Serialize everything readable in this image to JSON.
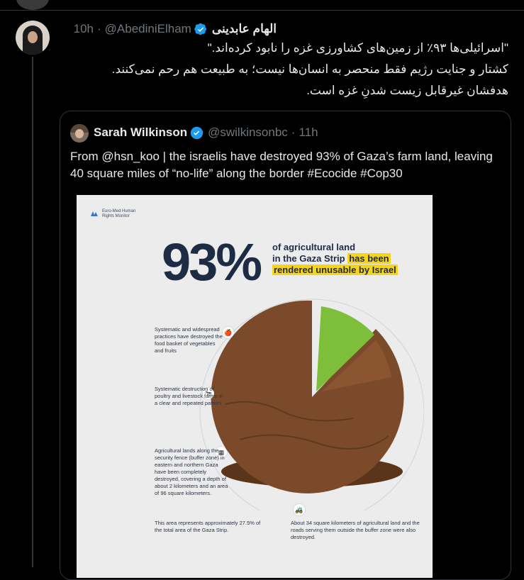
{
  "main_tweet": {
    "name": "الهام عابدینی",
    "handle": "@AbediniElham",
    "time": "10h",
    "lines": [
      "\"اسرائیلی‌ها ۹۳٪ از زمین‌های کشاورزی غزه را نابود کرده‌اند.\"",
      "کشتار و جنایت رژیم فقط منحصر به انسان‌ها نیست؛ به طبیعت هم رحم نمی‌کنند.",
      "هدفشان غیرقابل زیست شدنِ غزه است."
    ]
  },
  "quoted_tweet": {
    "name": "Sarah Wilkinson",
    "handle": "@swilkinsonbc",
    "time": "11h",
    "text": "From @hsn_koo | the israelis have destroyed 93% of Gaza’s farm land, leaving 40 square miles of “no-life” along the border #Ecocide #Cop30"
  },
  "poster": {
    "org_line1": "Euro-Med Human",
    "org_line2": "Rights Monitor",
    "big_number": "93%",
    "head_line1": "of agricultural land",
    "head_line2a": "in the Gaza Strip ",
    "head_line2b": "has been",
    "head_line3": "rendered unusable by Israel",
    "note1": "Systematic and widespread practices have destroyed the food basket of vegetables and fruits",
    "note2": "Systematic destruction of poultry and livestock farms in a clear and repeated pattern",
    "note3": "Agricultural lands along the security fence (buffer zone) in eastern and northern Gaza have been completely destroyed, covering a depth of about 2 kilometers and an area of 96 square kilometers.",
    "note4": "This area represents approximately 27.5% of the total area of the Gaza Strip.",
    "note5": "About 34 square kilometers of agricultural land and the roads serving them outside the buffer zone were also destroyed."
  },
  "colors": {
    "verified": "#1d9bf0",
    "highlight": "#f5d41a",
    "soil": "#7a4a2a",
    "green": "#7dbf3a"
  }
}
